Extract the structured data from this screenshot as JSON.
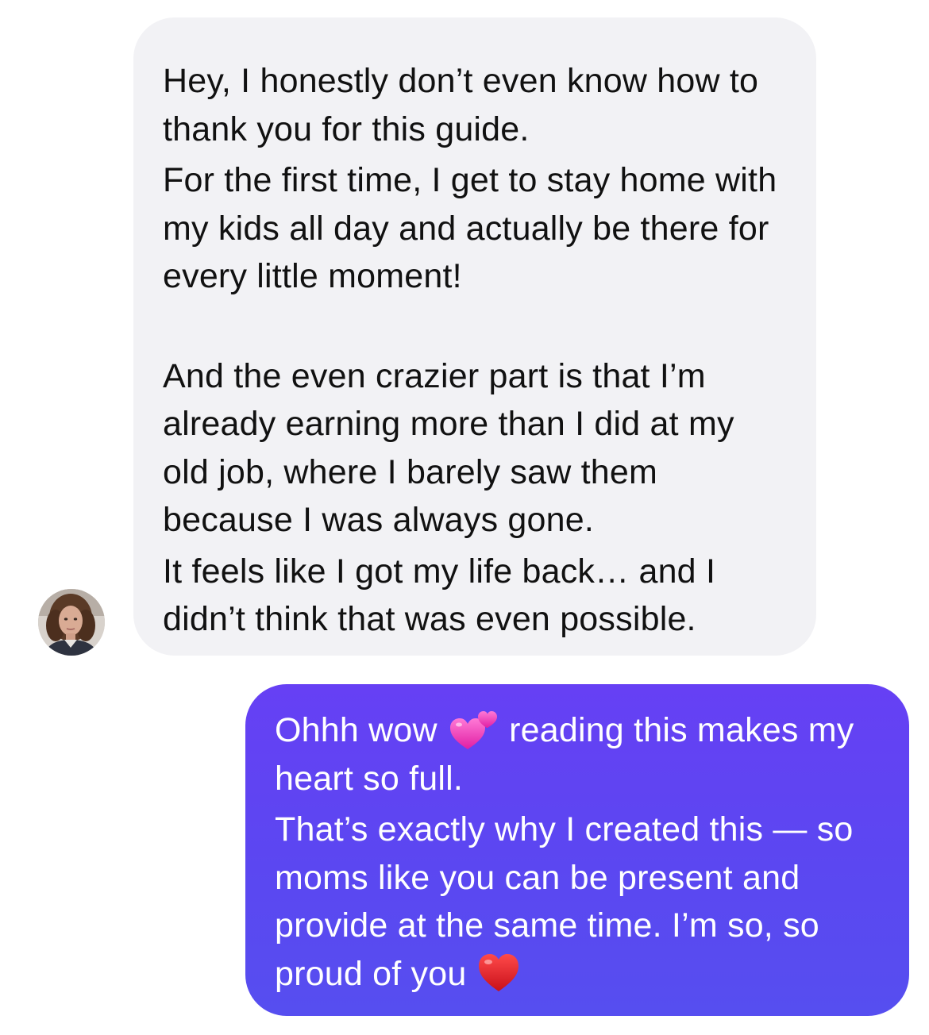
{
  "conversation": {
    "incoming": {
      "sender_avatar_icon": "profile-photo",
      "paragraphs": [
        "Hey, I honestly don’t even know how to thank you for this guide.",
        "For the first time, I get to stay home with my kids all day and actually be there for every little moment!",
        "And the even crazier part is that I’m already earning more than I did at my old job, where I barely saw them because I was always gone.",
        "It feels like I got my life back… and I didn’t think that was even possible."
      ]
    },
    "outgoing": {
      "line1_before_emoji": "Ohhh wow",
      "emoji_1": "two-hearts-icon",
      "line1_after_emoji": "reading this makes my heart so full.",
      "paragraph_2": "That’s exactly why I created this — so moms like you can be present and provide at the same time. I’m so, so proud of you",
      "emoji_2": "red-heart-icon"
    }
  },
  "colors": {
    "incoming_bubble": "#f2f2f5",
    "incoming_text": "#111111",
    "outgoing_bubble_top": "#6640f4",
    "outgoing_bubble_bottom": "#564ef0",
    "outgoing_text": "#ffffff"
  }
}
